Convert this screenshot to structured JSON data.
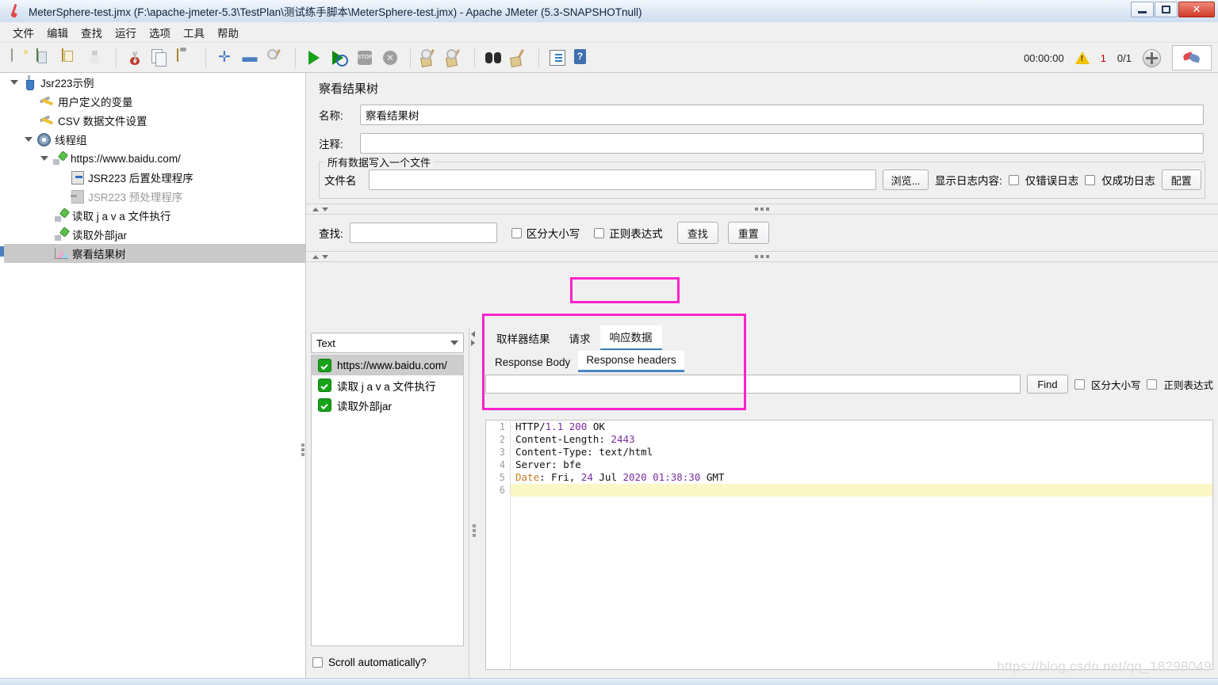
{
  "window": {
    "title": "MeterSphere-test.jmx (F:\\apache-jmeter-5.3\\TestPlan\\测试练手脚本\\MeterSphere-test.jmx) - Apache JMeter (5.3-SNAPSHOTnull)",
    "app_icon": "jmeter-flask-icon",
    "controls": {
      "minimize": "minimize-button",
      "maximize": "maximize-button",
      "close": "✕"
    }
  },
  "menubar": {
    "items": [
      "文件",
      "编辑",
      "查找",
      "运行",
      "选项",
      "工具",
      "帮助"
    ]
  },
  "toolbar": {
    "buttons": [
      {
        "name": "new-icon",
        "title": "新建"
      },
      {
        "name": "templates-icon",
        "title": "模板"
      },
      {
        "name": "open-icon",
        "title": "打开"
      },
      {
        "name": "save-icon",
        "title": "保存"
      },
      {
        "name": "cut-icon",
        "title": "剪切"
      },
      {
        "name": "copy-icon",
        "title": "复制"
      },
      {
        "name": "paste-icon",
        "title": "粘贴"
      },
      {
        "name": "expand-all-icon",
        "title": "展开全部"
      },
      {
        "name": "collapse-all-icon",
        "title": "收起全部"
      },
      {
        "name": "toggle-icon",
        "title": "启用/禁用"
      },
      {
        "name": "start-icon",
        "title": "启动"
      },
      {
        "name": "start-no-pauses-icon",
        "title": "无间隔启动"
      },
      {
        "name": "stop-icon",
        "title": "停止"
      },
      {
        "name": "shutdown-icon",
        "title": "关闭"
      },
      {
        "name": "clear-icon",
        "title": "清除"
      },
      {
        "name": "clear-all-icon",
        "title": "清除全部"
      },
      {
        "name": "search-icon",
        "title": "查找"
      },
      {
        "name": "reset-search-icon",
        "title": "重置查找"
      },
      {
        "name": "function-helper-icon",
        "title": "函数助手"
      },
      {
        "name": "help-icon",
        "title": "帮助"
      }
    ],
    "status": {
      "elapsed": "00:00:00",
      "warning_count": "1",
      "threads": "0/1",
      "nav_icon": "crosshair-icon",
      "brand_icon": "jmeter-logo-icon"
    }
  },
  "tree": {
    "nodes": [
      {
        "label": "Jsr223示例",
        "icon": "test-plan-icon",
        "indent": 0,
        "toggle": "down",
        "selected": false,
        "dim": false
      },
      {
        "label": "用户定义的变量",
        "icon": "config-wrench-icon",
        "indent": 1,
        "toggle": "",
        "selected": false,
        "dim": false
      },
      {
        "label": "CSV 数据文件设置",
        "icon": "config-wrench-icon",
        "indent": 1,
        "toggle": "",
        "selected": false,
        "dim": false
      },
      {
        "label": "线程组",
        "icon": "thread-group-icon",
        "indent": 1,
        "toggle": "down",
        "selected": false,
        "dim": false
      },
      {
        "label": "https://www.baidu.com/",
        "icon": "http-sampler-icon",
        "indent": 2,
        "toggle": "down",
        "selected": false,
        "dim": false
      },
      {
        "label": "JSR223 后置处理程序",
        "icon": "post-processor-icon",
        "indent": 3,
        "toggle": "",
        "selected": false,
        "dim": false
      },
      {
        "label": "JSR223 预处理程序",
        "icon": "pre-processor-icon",
        "indent": 3,
        "toggle": "",
        "selected": false,
        "dim": true
      },
      {
        "label": "读取 j a v a 文件执行",
        "icon": "http-sampler-icon",
        "indent": 2,
        "toggle": "",
        "selected": false,
        "dim": false
      },
      {
        "label": "读取外部jar",
        "icon": "http-sampler-icon",
        "indent": 2,
        "toggle": "",
        "selected": false,
        "dim": false
      },
      {
        "label": "察看结果树",
        "icon": "view-results-tree-icon",
        "indent": 2,
        "toggle": "",
        "selected": true,
        "dim": false
      }
    ]
  },
  "panel": {
    "title": "察看结果树",
    "name_label": "名称:",
    "name_value": "察看结果树",
    "comment_label": "注释:",
    "comment_value": "",
    "group_legend": "所有数据写入一个文件",
    "filename_label": "文件名",
    "filename_value": "",
    "browse_button": "浏览...",
    "log_display_label": "显示日志内容:",
    "errors_only_label": "仅错误日志",
    "success_only_label": "仅成功日志",
    "configure_button": "配置"
  },
  "search": {
    "label": "查找:",
    "value": "",
    "case_sensitive_label": "区分大小写",
    "regex_label": "正则表达式",
    "find_button": "查找",
    "reset_button": "重置"
  },
  "results": {
    "renderer": "Text",
    "renderer_options": [
      "Text"
    ],
    "items": [
      {
        "label": "https://www.baidu.com/",
        "status": "success",
        "selected": true
      },
      {
        "label": "读取 j a v a 文件执行",
        "status": "success",
        "selected": false
      },
      {
        "label": "读取外部jar",
        "status": "success",
        "selected": false
      }
    ],
    "scroll_automatically_label": "Scroll automatically?"
  },
  "response": {
    "primary_tabs": [
      {
        "label": "取样器结果",
        "active": false
      },
      {
        "label": "请求",
        "active": false
      },
      {
        "label": "响应数据",
        "active": true
      }
    ],
    "secondary_tabs": [
      {
        "label": "Response Body",
        "active": false
      },
      {
        "label": "Response headers",
        "active": true
      }
    ],
    "find_input_value": "",
    "find_button": "Find",
    "case_sensitive_label": "区分大小写",
    "regex_label": "正则表达式",
    "lines": [
      {
        "n": "1",
        "tokens": [
          {
            "t": "HTTP/",
            "c": "plain"
          },
          {
            "t": "1.1",
            "c": "num"
          },
          {
            "t": " ",
            "c": "plain"
          },
          {
            "t": "200",
            "c": "num"
          },
          {
            "t": " OK",
            "c": "plain"
          }
        ],
        "current": false
      },
      {
        "n": "2",
        "tokens": [
          {
            "t": "Content-Length: ",
            "c": "plain"
          },
          {
            "t": "2443",
            "c": "num"
          }
        ],
        "current": false
      },
      {
        "n": "3",
        "tokens": [
          {
            "t": "Content-Type: text/html",
            "c": "plain"
          }
        ],
        "current": false
      },
      {
        "n": "4",
        "tokens": [
          {
            "t": "Server: bfe",
            "c": "plain"
          }
        ],
        "current": false
      },
      {
        "n": "5",
        "tokens": [
          {
            "t": "Date",
            "c": "key-date"
          },
          {
            "t": ": Fri, ",
            "c": "plain"
          },
          {
            "t": "24",
            "c": "num"
          },
          {
            "t": " Jul ",
            "c": "plain"
          },
          {
            "t": "2020",
            "c": "num"
          },
          {
            "t": " ",
            "c": "plain"
          },
          {
            "t": "01:38:30",
            "c": "num"
          },
          {
            "t": " GMT",
            "c": "plain"
          }
        ],
        "current": false
      },
      {
        "n": "6",
        "tokens": [
          {
            "t": "",
            "c": "plain"
          }
        ],
        "current": true
      }
    ]
  },
  "annotations": {
    "tab_highlight": "Response headers",
    "content_highlight": "response-headers-text",
    "color": "#ff22cc"
  },
  "watermark": "https://blog.csdn.net/qq_18298049",
  "colors": {
    "accent": "#4a7fc1",
    "tab_underline": "#4a86c5",
    "annotation": "#ff22cc",
    "number_token": "#7b2d9e",
    "date_token": "#c77a20",
    "current_line": "#fbf7c6",
    "success": "#18a318",
    "warning": "#c00000"
  }
}
